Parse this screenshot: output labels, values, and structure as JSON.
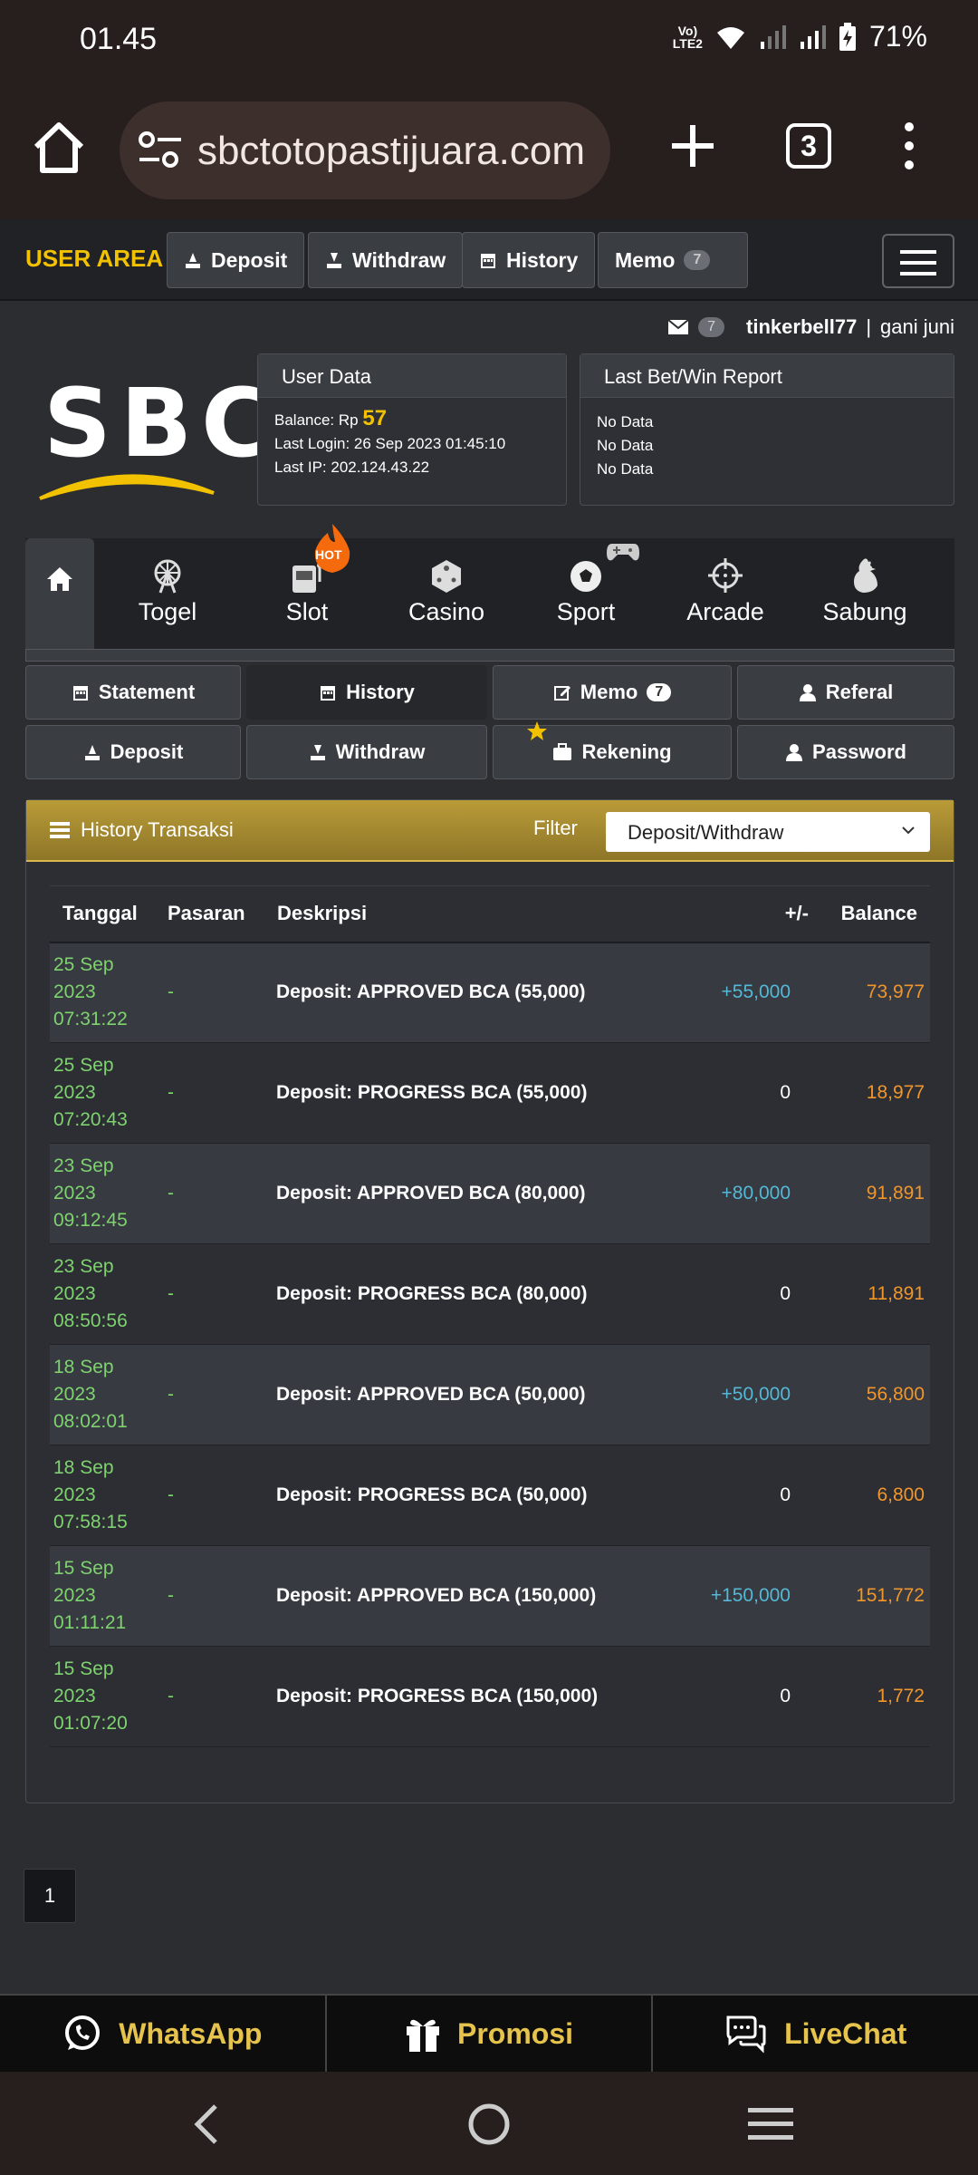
{
  "status_bar": {
    "time": "01.45",
    "volte": "Vo) LTE2",
    "battery": "71%"
  },
  "browser": {
    "url": "sbctotopastijuara.com",
    "tab_count": "3"
  },
  "nav": {
    "user_area": "USER AREA",
    "deposit": "Deposit",
    "withdraw": "Withdraw",
    "history": "History",
    "memo": "Memo",
    "memo_count": "7"
  },
  "user": {
    "mail_count": "7",
    "username": "tinkerbell77",
    "separator": "|",
    "name": "gani juni"
  },
  "logo": {
    "text": "SBC"
  },
  "user_data": {
    "title": "User Data",
    "balance_label": "Balance: Rp",
    "balance_value": "57",
    "last_login": "Last Login: 26 Sep 2023 01:45:10",
    "last_ip": "Last IP: 202.124.43.22"
  },
  "report": {
    "title": "Last Bet/Win Report",
    "lines": [
      "No Data",
      "No Data",
      "No Data"
    ]
  },
  "categories": [
    {
      "label": "Togel",
      "icon": "ferris-wheel-icon"
    },
    {
      "label": "Slot",
      "icon": "slot-machine-icon"
    },
    {
      "label": "Casino",
      "icon": "dice-icon"
    },
    {
      "label": "Sport",
      "icon": "soccer-ball-icon"
    },
    {
      "label": "Arcade",
      "icon": "crosshair-icon"
    },
    {
      "label": "Sabung",
      "icon": "rooster-icon"
    }
  ],
  "hot_badge": "HOT",
  "tabs": {
    "statement": "Statement",
    "history": "History",
    "memo": "Memo",
    "memo_count": "7",
    "referal": "Referal",
    "deposit": "Deposit",
    "withdraw": "Withdraw",
    "rekening": "Rekening",
    "password": "Password"
  },
  "history": {
    "title": "History Transaksi",
    "filter_label": "Filter",
    "filter_value": "Deposit/Withdraw",
    "columns": {
      "date": "Tanggal",
      "market": "Pasaran",
      "desc": "Deskripsi",
      "delta": "+/-",
      "balance": "Balance"
    },
    "rows": [
      {
        "d1": "25 Sep",
        "d2": "2023",
        "d3": "07:31:22",
        "market": "-",
        "desc": "Deposit: APPROVED BCA (55,000)",
        "delta": "+55,000",
        "balance": "73,977"
      },
      {
        "d1": "25 Sep",
        "d2": "2023",
        "d3": "07:20:43",
        "market": "-",
        "desc": "Deposit: PROGRESS BCA (55,000)",
        "delta": "0",
        "balance": "18,977"
      },
      {
        "d1": "23 Sep",
        "d2": "2023",
        "d3": "09:12:45",
        "market": "-",
        "desc": "Deposit: APPROVED BCA (80,000)",
        "delta": "+80,000",
        "balance": "91,891"
      },
      {
        "d1": "23 Sep",
        "d2": "2023",
        "d3": "08:50:56",
        "market": "-",
        "desc": "Deposit: PROGRESS BCA (80,000)",
        "delta": "0",
        "balance": "11,891"
      },
      {
        "d1": "18 Sep",
        "d2": "2023",
        "d3": "08:02:01",
        "market": "-",
        "desc": "Deposit: APPROVED BCA (50,000)",
        "delta": "+50,000",
        "balance": "56,800"
      },
      {
        "d1": "18 Sep",
        "d2": "2023",
        "d3": "07:58:15",
        "market": "-",
        "desc": "Deposit: PROGRESS BCA (50,000)",
        "delta": "0",
        "balance": "6,800"
      },
      {
        "d1": "15 Sep",
        "d2": "2023",
        "d3": "01:11:21",
        "market": "-",
        "desc": "Deposit: APPROVED BCA (150,000)",
        "delta": "+150,000",
        "balance": "151,772"
      },
      {
        "d1": "15 Sep",
        "d2": "2023",
        "d3": "01:07:20",
        "market": "-",
        "desc": "Deposit: PROGRESS BCA (150,000)",
        "delta": "0",
        "balance": "1,772"
      }
    ]
  },
  "pagination": {
    "current": "1"
  },
  "bottom_bar": {
    "whatsapp": "WhatsApp",
    "promosi": "Promosi",
    "livechat": "LiveChat"
  },
  "colors": {
    "accent": "#f2c200",
    "green": "#7ed36f",
    "blue": "#54b8d6",
    "orange": "#f0962b",
    "gold": "#e6c34c"
  }
}
